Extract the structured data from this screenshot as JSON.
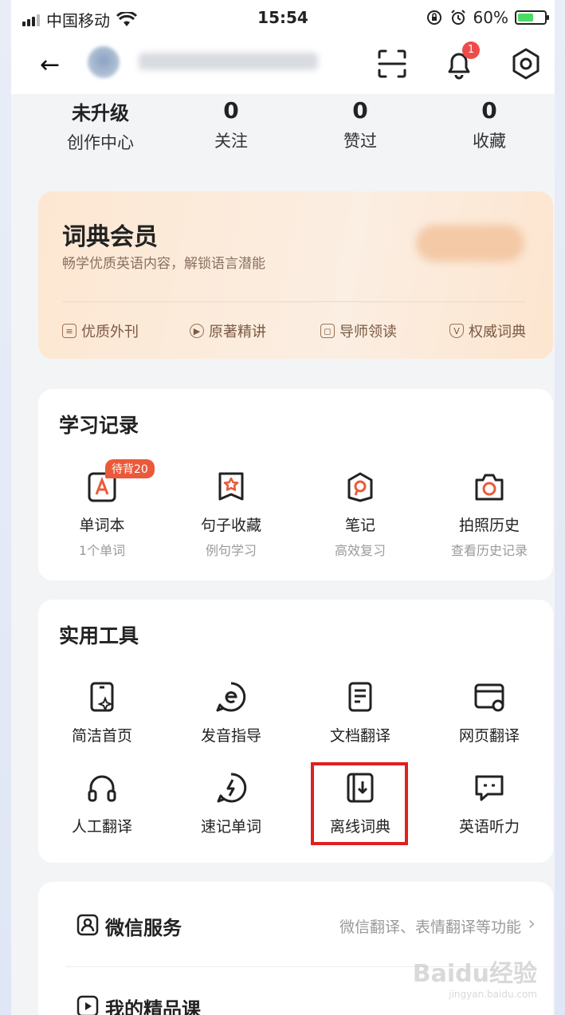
{
  "status_bar": {
    "carrier": "中国移动",
    "time": "15:54",
    "battery": "60%",
    "battery_level": 0.6
  },
  "header": {
    "notification_count": "1"
  },
  "stats": [
    {
      "value": "未升级",
      "label": "创作中心"
    },
    {
      "value": "0",
      "label": "关注"
    },
    {
      "value": "0",
      "label": "赞过"
    },
    {
      "value": "0",
      "label": "收藏"
    }
  ],
  "vip": {
    "title": "词典会员",
    "subtitle": "畅学优质英语内容，解锁语言潜能",
    "perks": [
      "优质外刊",
      "原著精讲",
      "导师领读",
      "权威词典"
    ]
  },
  "study": {
    "title": "学习记录",
    "items": [
      {
        "name": "单词本",
        "desc": "1个单词",
        "tag": "待背20"
      },
      {
        "name": "句子收藏",
        "desc": "例句学习"
      },
      {
        "name": "笔记",
        "desc": "高效复习"
      },
      {
        "name": "拍照历史",
        "desc": "查看历史记录"
      }
    ]
  },
  "tools": {
    "title": "实用工具",
    "items": [
      "简洁首页",
      "发音指导",
      "文档翻译",
      "网页翻译",
      "人工翻译",
      "速记单词",
      "离线词典",
      "英语听力"
    ]
  },
  "services": {
    "wechat_title": "微信服务",
    "wechat_desc": "微信翻译、表情翻译等功能",
    "courses_title": "我的精品课"
  },
  "watermark": {
    "text": "Baidu经验",
    "sub": "jingyan.baidu.com"
  },
  "colors": {
    "accent": "#ea5a3a",
    "highlight": "#e02020",
    "vip_bg": "#fde7d2"
  }
}
